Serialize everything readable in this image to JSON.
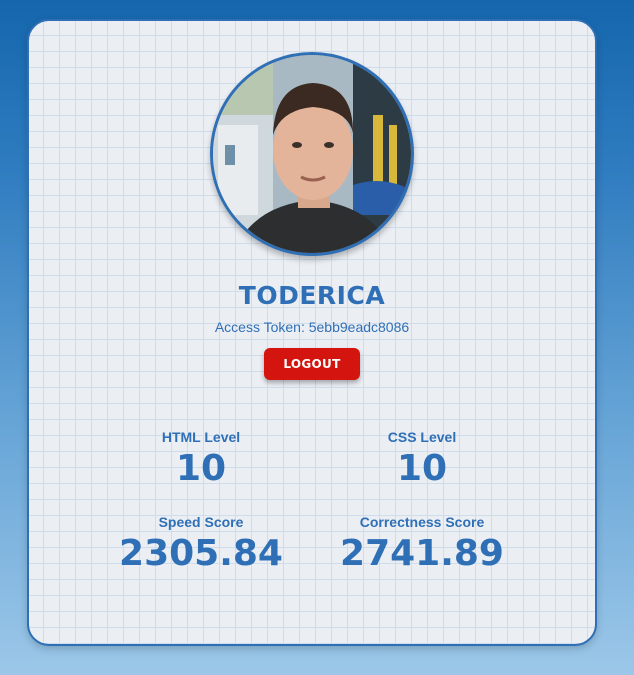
{
  "profile": {
    "name": "TODERICA",
    "access_token": "Access Token: 5ebb9eadc8086",
    "logout_label": "LOGOUT"
  },
  "stats": {
    "html_level_label": "HTML Level",
    "html_level_value": "10",
    "css_level_label": "CSS Level",
    "css_level_value": "10",
    "speed_score_label": "Speed Score",
    "speed_score_value": "2305.84",
    "correctness_score_label": "Correctness Score",
    "correctness_score_value": "2741.89"
  },
  "colors": {
    "accent": "#2f6fb6",
    "logout": "#d4150f",
    "card_bg": "#ebeff4"
  }
}
